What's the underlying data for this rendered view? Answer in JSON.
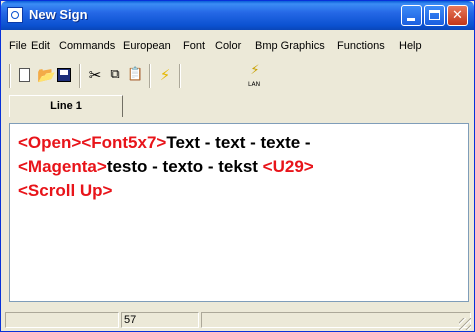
{
  "window": {
    "title": "New Sign",
    "controls": {
      "minimize": "minimize-icon",
      "maximize": "maximize-icon",
      "close": "close-icon"
    },
    "colors": {
      "titlebar": "#0b51d0",
      "tag_text": "#e8141a",
      "plain_text": "#000000"
    }
  },
  "menu": {
    "items": [
      "File",
      "Edit",
      "Commands",
      "European",
      "Font",
      "Color",
      "Bmp Graphics",
      "Functions",
      "Help"
    ]
  },
  "toolbar": {
    "icons": [
      "new-document-icon",
      "open-folder-icon",
      "save-disk-icon",
      "cut-scissors-icon",
      "copy-icon",
      "paste-icon",
      "send-flash-icon",
      "lan-icon"
    ],
    "lan_label": "LAN"
  },
  "tabs": [
    {
      "label": "Line 1",
      "active": true
    }
  ],
  "editor": {
    "segments": [
      {
        "text": "<Open>",
        "type": "tag"
      },
      {
        "text": "<Font5x7>",
        "type": "tag"
      },
      {
        "text": "Text - text - texte -",
        "type": "text"
      },
      {
        "text": "<Magenta>",
        "type": "tag"
      },
      {
        "text": "testo - texto - tekst ",
        "type": "text"
      },
      {
        "text": "<U29>",
        "type": "tag"
      },
      {
        "text": "<Scroll Up>",
        "type": "tag"
      }
    ]
  },
  "statusbar": {
    "cells": [
      "",
      "57",
      ""
    ]
  }
}
